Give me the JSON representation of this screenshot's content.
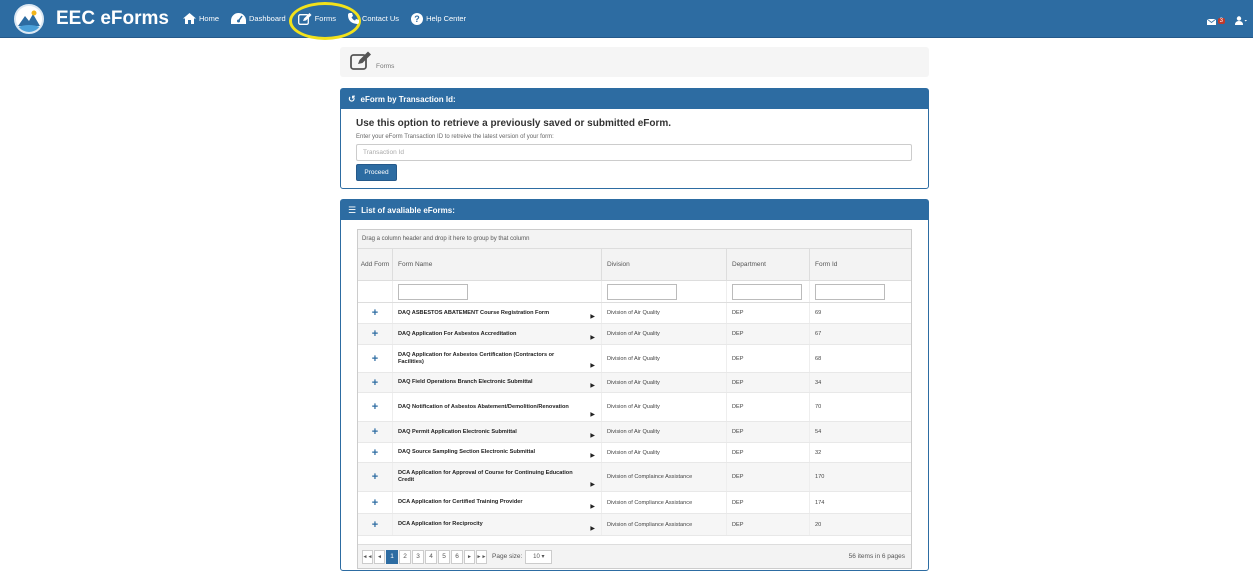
{
  "navbar": {
    "brand": "EEC eForms",
    "items": [
      {
        "label": "Home",
        "icon": "home-icon"
      },
      {
        "label": "Dashboard",
        "icon": "dashboard-icon"
      },
      {
        "label": "Forms",
        "icon": "edit-icon"
      },
      {
        "label": "Contact Us",
        "icon": "phone-icon"
      },
      {
        "label": "Help Center",
        "icon": "question-icon"
      }
    ],
    "mail_count": "3"
  },
  "breadcrumb": {
    "label": "Forms"
  },
  "transaction_panel": {
    "heading": "eForm by Transaction Id:",
    "title": "Use this option to retrieve a previously saved or submitted eForm.",
    "hint": "Enter your eForm Transaction ID to retreive the latest version of your form:",
    "input_placeholder": "Transaction Id",
    "input_value": "",
    "button_label": "Proceed"
  },
  "forms_panel": {
    "heading": "List of avaliable eForms:",
    "group_hint": "Drag a column header and drop it here to group by that column",
    "columns": [
      "Add Form",
      "Form Name",
      "Division",
      "Department",
      "Form Id"
    ],
    "rows": [
      {
        "name": "DAQ ASBESTOS ABATEMENT Course Registration Form",
        "division": "Division of Air Quality",
        "department": "DEP",
        "id": "69"
      },
      {
        "name": "DAQ Application For Asbestos Accreditation",
        "division": "Division of Air Quality",
        "department": "DEP",
        "id": "67"
      },
      {
        "name": "DAQ Application for Asbestos Certification (Contractors or Facilities)",
        "division": "Division of Air Quality",
        "department": "DEP",
        "id": "68"
      },
      {
        "name": "DAQ Field Operations Branch Electronic Submittal",
        "division": "Division of Air Quality",
        "department": "DEP",
        "id": "34"
      },
      {
        "name": "DAQ Notification of Asbestos Abatement/Demolition/Renovation",
        "division": "Division of Air Quality",
        "department": "DEP",
        "id": "70"
      },
      {
        "name": "DAQ Permit Application Electronic Submittal",
        "division": "Division of Air Quality",
        "department": "DEP",
        "id": "54"
      },
      {
        "name": "DAQ Source Sampling Section Electronic Submittal",
        "division": "Division of Air Quality",
        "department": "DEP",
        "id": "32"
      },
      {
        "name": "DCA Application for Approval of Course for Continuing Education Credit",
        "division": "Division of Complaince Assistance",
        "department": "DEP",
        "id": "170"
      },
      {
        "name": "DCA Application for Certified Training Provider",
        "division": "Division of Compliance Assistance",
        "department": "DEP",
        "id": "174"
      },
      {
        "name": "DCA Application for Reciprocity",
        "division": "Division of Compliance Assistance",
        "department": "DEP",
        "id": "20"
      }
    ],
    "pager": {
      "pages": [
        "1",
        "2",
        "3",
        "4",
        "5",
        "6"
      ],
      "current": "1",
      "page_size_label": "Page size:",
      "page_size": "10",
      "info": "56 items in 6 pages"
    }
  },
  "colors": {
    "primary": "#2d6ca2",
    "highlight": "#f2e21b"
  }
}
